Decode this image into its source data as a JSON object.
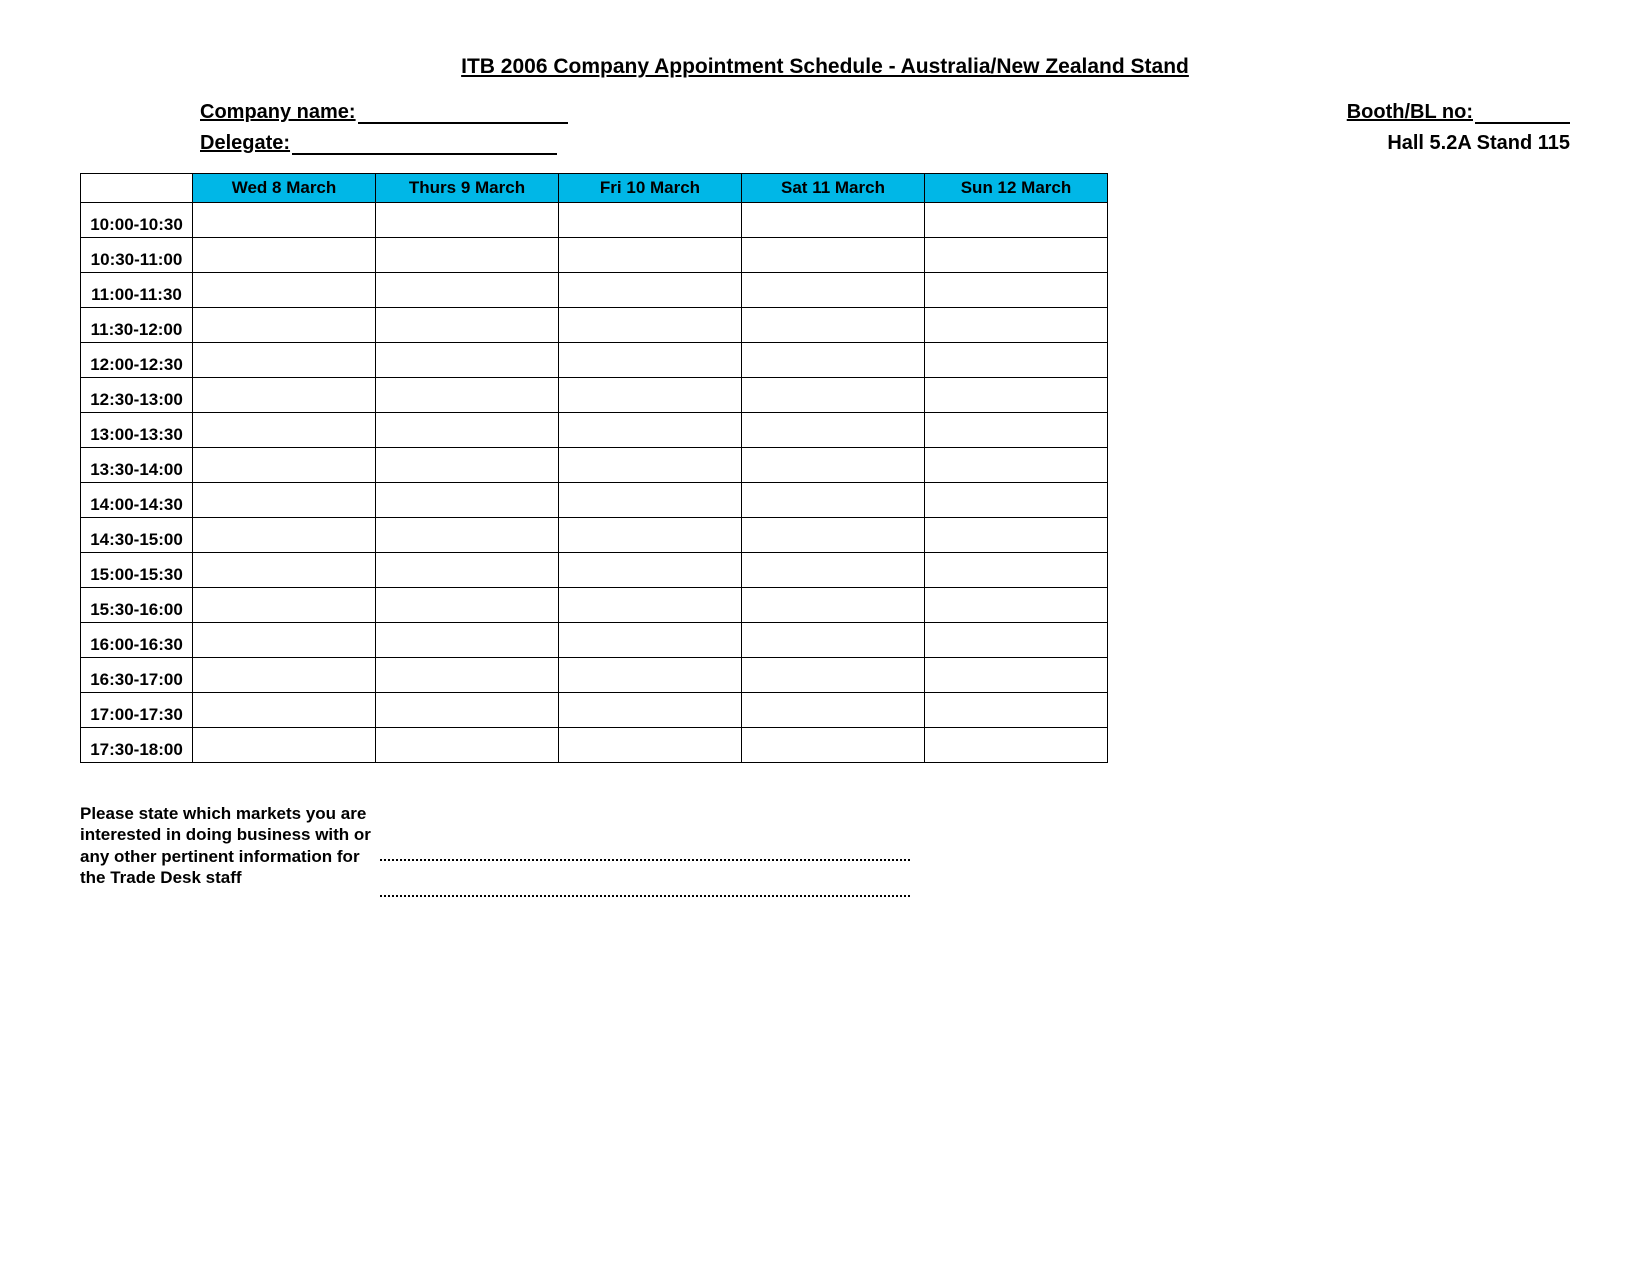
{
  "title": "ITB 2006 Company Appointment Schedule - Australia/New Zealand Stand",
  "labels": {
    "company": "Company name:",
    "booth": "Booth/BL no:",
    "delegate": "Delegate:"
  },
  "location": "Hall 5.2A Stand 115",
  "days": [
    "Wed 8 March",
    "Thurs 9 March",
    "Fri 10 March",
    "Sat 11 March",
    "Sun 12 March"
  ],
  "timeslots": [
    "10:00-10:30",
    "10:30-11:00",
    "11:00-11:30",
    "11:30-12:00",
    "12:00-12:30",
    "12:30-13:00",
    "13:00-13:30",
    "13:30-14:00",
    "14:00-14:30",
    "14:30-15:00",
    "15:00-15:30",
    "15:30-16:00",
    "16:00-16:30",
    "16:30-17:00",
    "17:00-17:30",
    "17:30-18:00"
  ],
  "footer_note": "Please state which markets you are interested in doing business with or any other pertinent information for the Trade Desk staff"
}
